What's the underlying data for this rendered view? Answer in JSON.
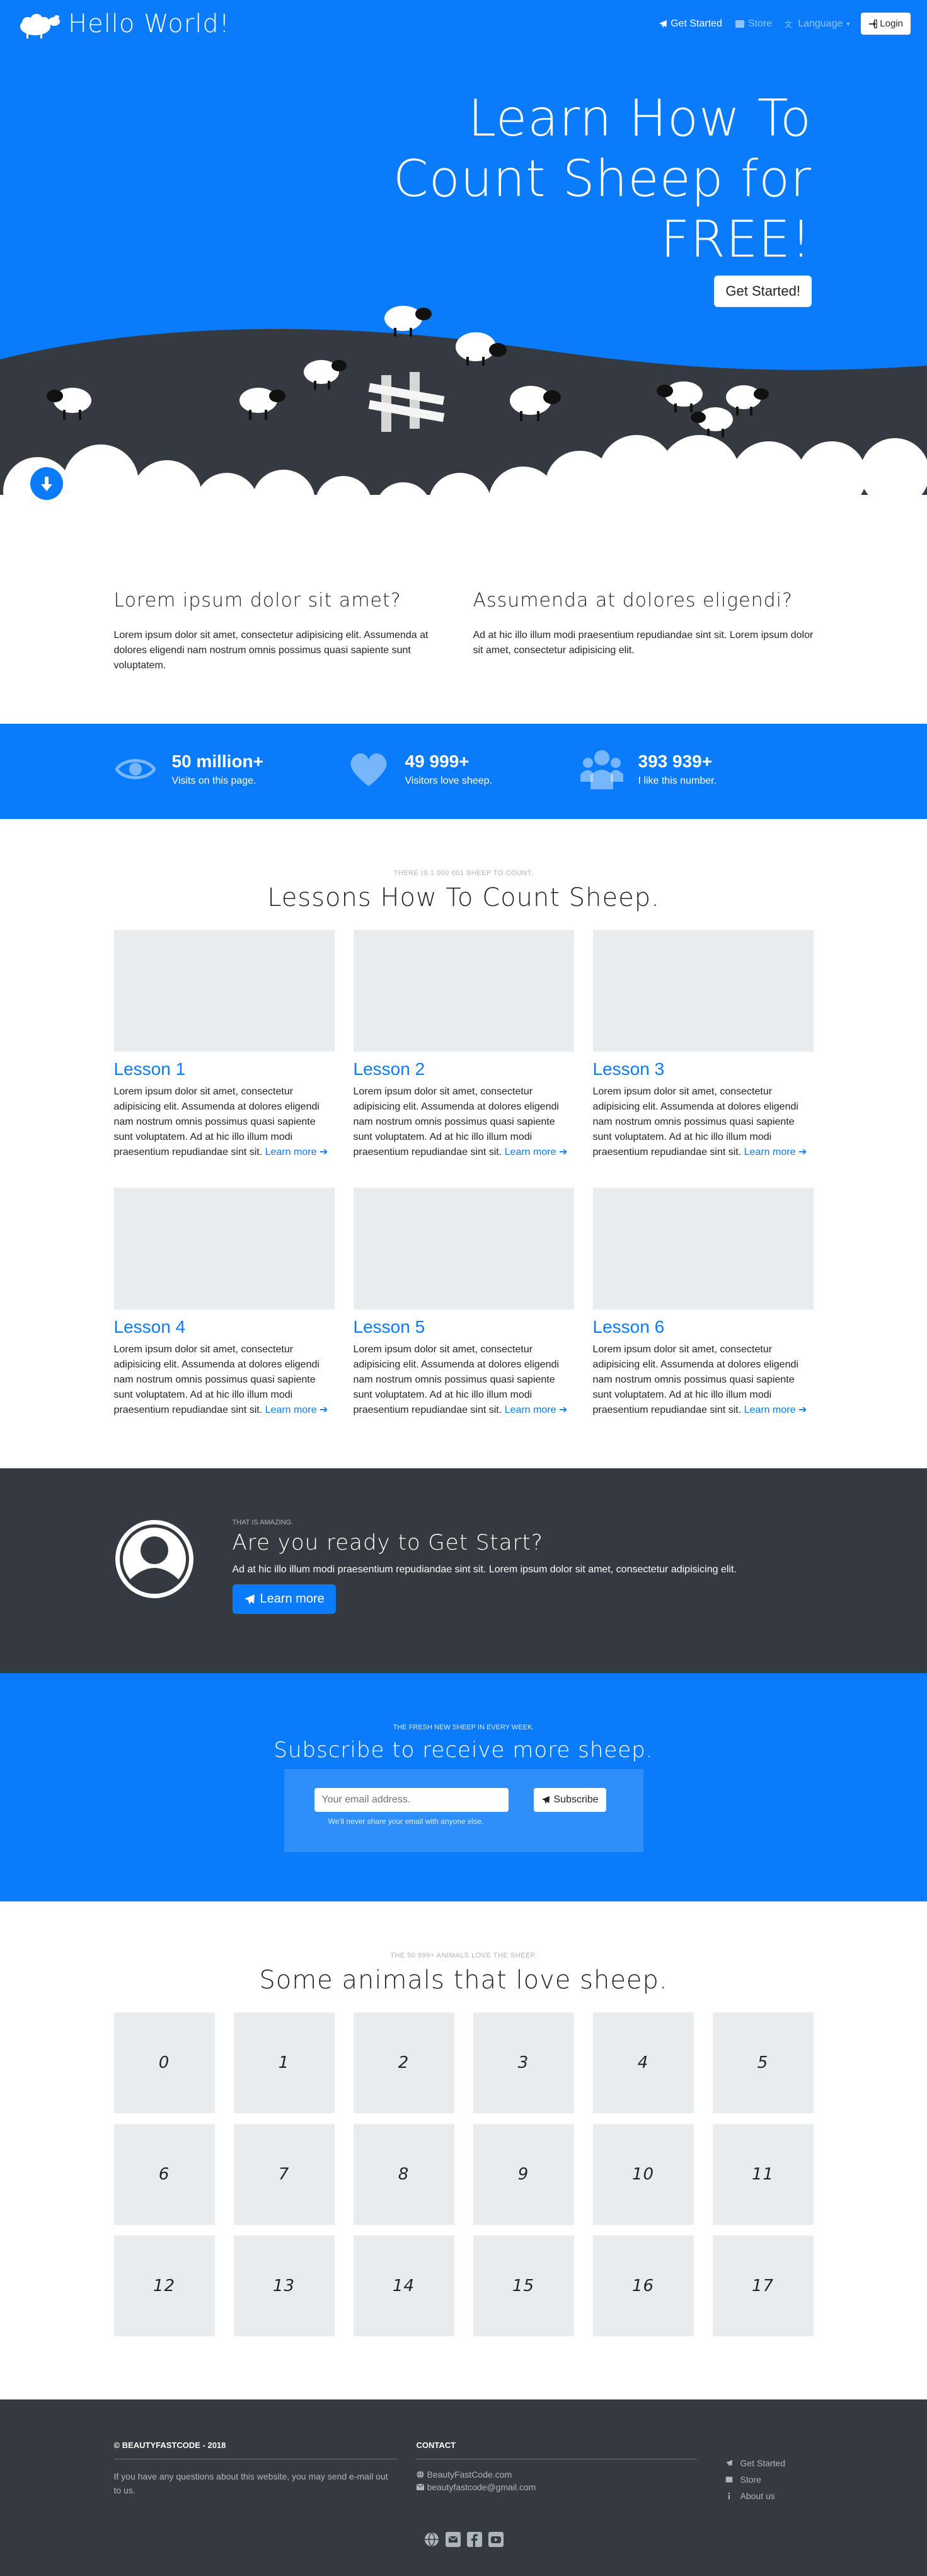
{
  "nav": {
    "brand": "Hello World!",
    "get_started": "Get Started",
    "store": "Store",
    "language": "Language",
    "login": "Login"
  },
  "hero": {
    "title_line1": "Learn How To",
    "title_line2": "Count Sheep for",
    "title_line3": "FREE!",
    "button": "Get Started!"
  },
  "features": [
    {
      "title": "Lorem ipsum dolor sit amet?",
      "text": "Lorem ipsum dolor sit amet, consectetur adipisicing elit. Assumenda at dolores eligendi nam nostrum omnis possimus quasi sapiente sunt voluptatem."
    },
    {
      "title": "Assumenda at dolores eligendi?",
      "text": "Ad at hic illo illum modi praesentium repudiandae sint sit. Lorem ipsum dolor sit amet, consectetur adipisicing elit."
    }
  ],
  "stats": [
    {
      "icon": "eye-icon",
      "value": "50 million+",
      "label": "Visits on this page."
    },
    {
      "icon": "heart-icon",
      "value": "49 999+",
      "label": "Visitors love sheep."
    },
    {
      "icon": "users-icon",
      "value": "393 939+",
      "label": "I like this number."
    }
  ],
  "lessons": {
    "kicker": "THERE IS 1 000 001 SHEEP TO COUNT.",
    "title": "Lessons How To Count Sheep.",
    "learn_more": "Learn more",
    "items": [
      {
        "title": "Lesson 1",
        "text": "Lorem ipsum dolor sit amet, consectetur adipisicing elit. Assumenda at dolores eligendi nam nostrum omnis possimus quasi sapiente sunt voluptatem. Ad at hic illo illum modi praesentium repudiandae sint sit."
      },
      {
        "title": "Lesson 2",
        "text": "Lorem ipsum dolor sit amet, consectetur adipisicing elit. Assumenda at dolores eligendi nam nostrum omnis possimus quasi sapiente sunt voluptatem. Ad at hic illo illum modi praesentium repudiandae sint sit."
      },
      {
        "title": "Lesson 3",
        "text": "Lorem ipsum dolor sit amet, consectetur adipisicing elit. Assumenda at dolores eligendi nam nostrum omnis possimus quasi sapiente sunt voluptatem. Ad at hic illo illum modi praesentium repudiandae sint sit."
      },
      {
        "title": "Lesson 4",
        "text": "Lorem ipsum dolor sit amet, consectetur adipisicing elit. Assumenda at dolores eligendi nam nostrum omnis possimus quasi sapiente sunt voluptatem. Ad at hic illo illum modi praesentium repudiandae sint sit."
      },
      {
        "title": "Lesson 5",
        "text": "Lorem ipsum dolor sit amet, consectetur adipisicing elit. Assumenda at dolores eligendi nam nostrum omnis possimus quasi sapiente sunt voluptatem. Ad at hic illo illum modi praesentium repudiandae sint sit."
      },
      {
        "title": "Lesson 6",
        "text": "Lorem ipsum dolor sit amet, consectetur adipisicing elit. Assumenda at dolores eligendi nam nostrum omnis possimus quasi sapiente sunt voluptatem. Ad at hic illo illum modi praesentium repudiandae sint sit."
      }
    ]
  },
  "cta": {
    "kicker": "THAT IS AMAZING.",
    "title": "Are you ready to Get Start?",
    "text": "Ad at hic illo illum modi praesentium repudiandae sint sit. Lorem ipsum dolor sit amet, consectetur adipisicing elit.",
    "button": "Learn more"
  },
  "subscribe": {
    "kicker": "THE FRESH NEW SHEEP IN EVERY WEEK.",
    "title": "Subscribe to receive more sheep.",
    "placeholder": "Your email address.",
    "button": "Subscribe",
    "note": "We'll never share your email with anyone else."
  },
  "animals": {
    "kicker": "THE 50 999+ ANIMALS LOVE THE SHEEP.",
    "title": "Some animals that love sheep.",
    "items": [
      "0",
      "1",
      "2",
      "3",
      "4",
      "5",
      "6",
      "7",
      "8",
      "9",
      "10",
      "11",
      "12",
      "13",
      "14",
      "15",
      "16",
      "17"
    ]
  },
  "footer": {
    "copyright": "© BEAUTYFASTCODE - 2018",
    "about": "If you have any questions about this website, you may send e-mail out to us.",
    "contact_title": "CONTACT",
    "website": "BeautyFastCode.com",
    "email": "beautyfastcode@gmail.com",
    "links": [
      "Get Started",
      "Store",
      "About us"
    ]
  },
  "colors": {
    "primary": "#0a7bfa",
    "dark": "#343a40",
    "placeholder": "#e9ecef"
  }
}
